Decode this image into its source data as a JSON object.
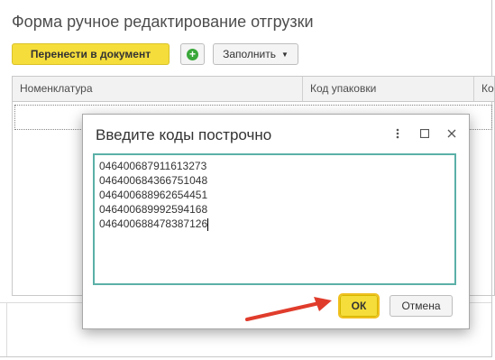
{
  "window": {
    "title": "Форма ручное редактирование отгрузки"
  },
  "toolbar": {
    "transfer_label": "Перенести в документ",
    "add_icon": "plus-circle-icon",
    "fill_label": "Заполнить",
    "accent_color": "#f5dd3b"
  },
  "table": {
    "columns": [
      "Номенклатура",
      "Код упаковки",
      "Ко"
    ]
  },
  "dialog": {
    "title": "Введите коды построчно",
    "codes_text": "046400687911613273\n046400684366751048\n046400688962654451\n046400689992594168\n046400688478387126",
    "ok_label": "ОК",
    "cancel_label": "Отмена",
    "arrow_color": "#e03c2c"
  }
}
